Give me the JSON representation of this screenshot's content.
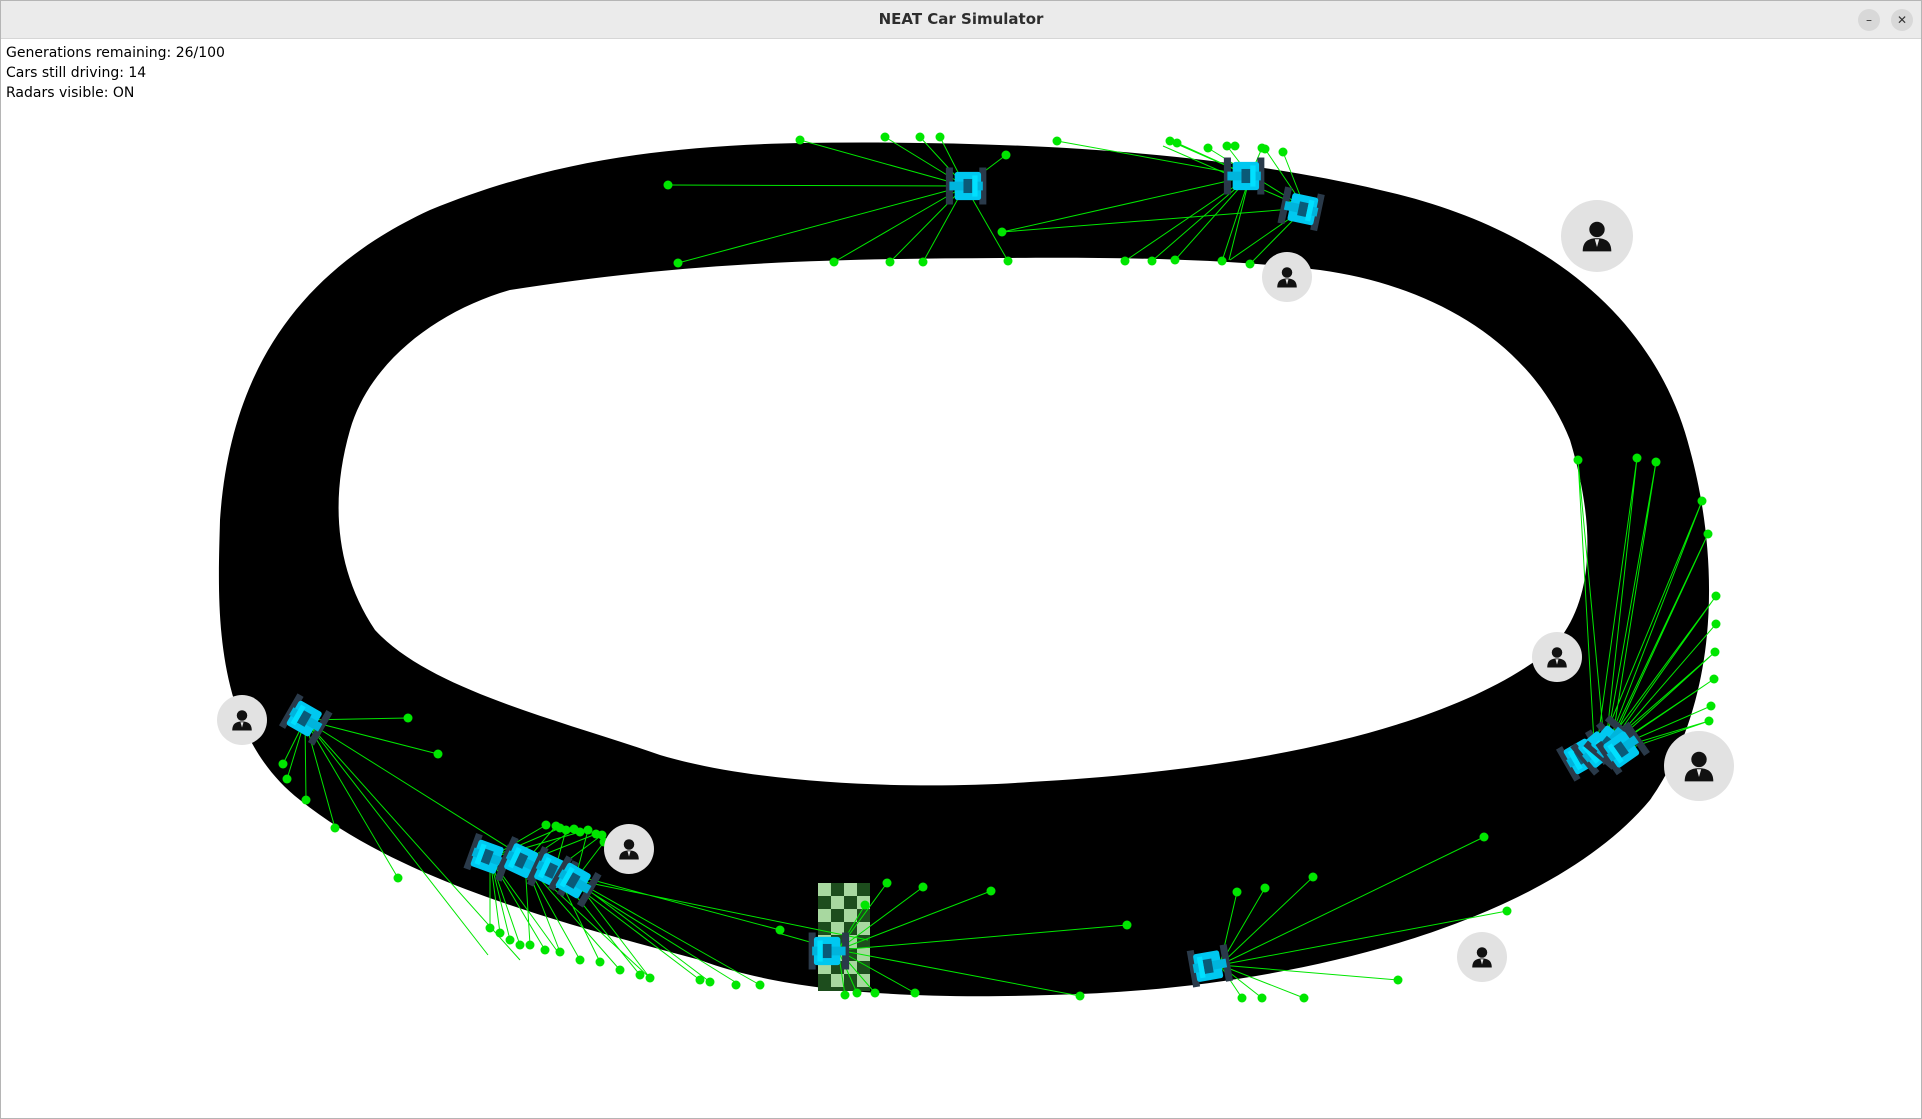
{
  "window": {
    "title": "NEAT Car Simulator",
    "minimize_glyph": "–",
    "close_glyph": "✕"
  },
  "hud": {
    "generations": "Generations remaining: 26/100",
    "cars_driving": "Cars still driving: 14",
    "radars": "Radars visible: ON"
  },
  "colors": {
    "track": "#000000",
    "radar": "#00e600",
    "car": "#00c8f0",
    "car_dark": "#2a3a4a",
    "spectator_bg": "#e2e2e2",
    "checker_light": "#a8d8a0",
    "checker_dark": "#1d4d1d"
  },
  "icons": [
    "minimize-icon",
    "close-icon",
    "person-icon",
    "car-icon"
  ]
}
